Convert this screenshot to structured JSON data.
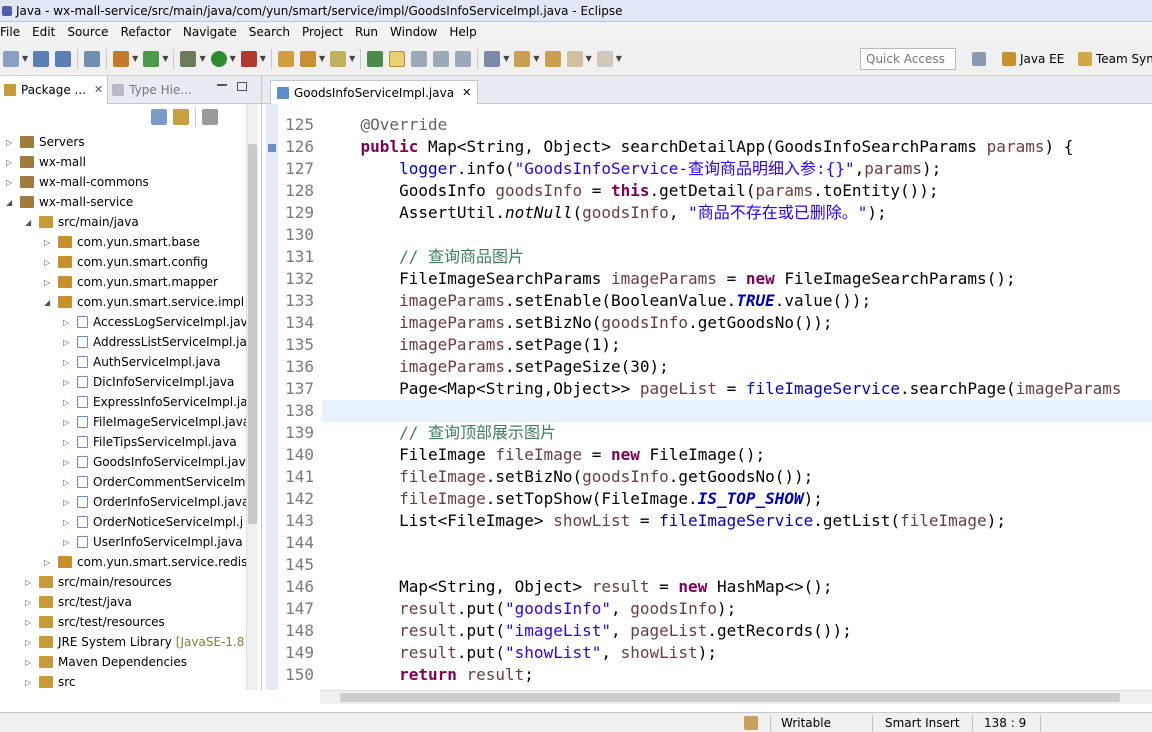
{
  "window": {
    "title": "Java - wx-mall-service/src/main/java/com/yun/smart/service/impl/GoodsInfoServiceImpl.java - Eclipse"
  },
  "menu": [
    "File",
    "Edit",
    "Source",
    "Refactor",
    "Navigate",
    "Search",
    "Project",
    "Run",
    "Window",
    "Help"
  ],
  "toolbar": {
    "quick_access_placeholder": "Quick Access",
    "perspectives": [
      "Java EE",
      "Team Syn"
    ]
  },
  "left_panel": {
    "tabs": [
      {
        "label": "Package ...",
        "close": "✕"
      },
      {
        "label": "Type Hie..."
      }
    ],
    "tree": [
      {
        "label": "Servers",
        "indent": 0,
        "expanded": false
      },
      {
        "label": "wx-mall",
        "indent": 0,
        "expanded": false
      },
      {
        "label": "wx-mall-commons",
        "indent": 0,
        "expanded": false
      },
      {
        "label": "wx-mall-service",
        "indent": 0,
        "expanded": true
      },
      {
        "label": "src/main/java",
        "indent": 1,
        "expanded": true
      },
      {
        "label": "com.yun.smart.base",
        "indent": 2,
        "expanded": false
      },
      {
        "label": "com.yun.smart.config",
        "indent": 2,
        "expanded": false
      },
      {
        "label": "com.yun.smart.mapper",
        "indent": 2,
        "expanded": false
      },
      {
        "label": "com.yun.smart.service.impl",
        "indent": 2,
        "expanded": true
      },
      {
        "label": "AccessLogServiceImpl.jav",
        "indent": 3,
        "expanded": false
      },
      {
        "label": "AddressListServiceImpl.ja",
        "indent": 3,
        "expanded": false
      },
      {
        "label": "AuthServiceImpl.java",
        "indent": 3,
        "expanded": false
      },
      {
        "label": "DicInfoServiceImpl.java",
        "indent": 3,
        "expanded": false
      },
      {
        "label": "ExpressInfoServiceImpl.ja",
        "indent": 3,
        "expanded": false
      },
      {
        "label": "FileImageServiceImpl.java",
        "indent": 3,
        "expanded": false
      },
      {
        "label": "FileTipsServiceImpl.java",
        "indent": 3,
        "expanded": false
      },
      {
        "label": "GoodsInfoServiceImpl.jav",
        "indent": 3,
        "expanded": false
      },
      {
        "label": "OrderCommentServiceIm",
        "indent": 3,
        "expanded": false
      },
      {
        "label": "OrderInfoServiceImpl.java",
        "indent": 3,
        "expanded": false
      },
      {
        "label": "OrderNoticeServiceImpl.j",
        "indent": 3,
        "expanded": false
      },
      {
        "label": "UserInfoServiceImpl.java",
        "indent": 3,
        "expanded": false
      },
      {
        "label": "com.yun.smart.service.redis",
        "indent": 2,
        "expanded": false
      },
      {
        "label": "src/main/resources",
        "indent": 1,
        "expanded": false
      },
      {
        "label": "src/test/java",
        "indent": 1,
        "expanded": false
      },
      {
        "label": "src/test/resources",
        "indent": 1,
        "expanded": false
      },
      {
        "label": "JRE System Library",
        "suffix": "[JavaSE-1.8]",
        "indent": 1,
        "expanded": false
      },
      {
        "label": "Maven Dependencies",
        "indent": 1,
        "expanded": false
      },
      {
        "label": "src",
        "indent": 1,
        "expanded": false
      }
    ]
  },
  "editor": {
    "tab": {
      "label": "GoodsInfoServiceImpl.java",
      "close": "✕"
    },
    "current_line": 138,
    "line_numbers": [
      "125",
      "126",
      "127",
      "128",
      "129",
      "130",
      "131",
      "132",
      "133",
      "134",
      "135",
      "136",
      "137",
      "138",
      "139",
      "140",
      "141",
      "142",
      "143",
      "144",
      "145",
      "146",
      "147",
      "148",
      "149",
      "150"
    ],
    "lines": [
      [
        {
          "t": "    "
        },
        {
          "t": "@Override",
          "c": "an"
        }
      ],
      [
        {
          "t": "    "
        },
        {
          "t": "public",
          "c": "kw"
        },
        {
          "t": " Map<String, Object> searchDetailApp(GoodsInfoSearchParams "
        },
        {
          "t": "params",
          "c": "var"
        },
        {
          "t": ") {"
        }
      ],
      [
        {
          "t": "        "
        },
        {
          "t": "logger",
          "c": "fld"
        },
        {
          "t": ".info("
        },
        {
          "t": "\"GoodsInfoService-查询商品明细入参:{}\"",
          "c": "st"
        },
        {
          "t": ","
        },
        {
          "t": "params",
          "c": "var"
        },
        {
          "t": ");"
        }
      ],
      [
        {
          "t": "        GoodsInfo "
        },
        {
          "t": "goodsInfo",
          "c": "var"
        },
        {
          "t": " = "
        },
        {
          "t": "this",
          "c": "kw"
        },
        {
          "t": ".getDetail("
        },
        {
          "t": "params",
          "c": "var"
        },
        {
          "t": ".toEntity());"
        }
      ],
      [
        {
          "t": "        AssertUtil."
        },
        {
          "t": "notNull",
          "c": "it"
        },
        {
          "t": "("
        },
        {
          "t": "goodsInfo",
          "c": "var"
        },
        {
          "t": ", "
        },
        {
          "t": "\"商品不存在或已删除。\"",
          "c": "st"
        },
        {
          "t": ");"
        }
      ],
      [
        {
          "t": ""
        }
      ],
      [
        {
          "t": "        "
        },
        {
          "t": "// 查询商品图片",
          "c": "cm"
        }
      ],
      [
        {
          "t": "        FileImageSearchParams "
        },
        {
          "t": "imageParams",
          "c": "var"
        },
        {
          "t": " = "
        },
        {
          "t": "new",
          "c": "kw"
        },
        {
          "t": " FileImageSearchParams();"
        }
      ],
      [
        {
          "t": "        "
        },
        {
          "t": "imageParams",
          "c": "var"
        },
        {
          "t": ".setEnable(BooleanValue."
        },
        {
          "t": "TRUE",
          "c": "sfi"
        },
        {
          "t": ".value());"
        }
      ],
      [
        {
          "t": "        "
        },
        {
          "t": "imageParams",
          "c": "var"
        },
        {
          "t": ".setBizNo("
        },
        {
          "t": "goodsInfo",
          "c": "var"
        },
        {
          "t": ".getGoodsNo());"
        }
      ],
      [
        {
          "t": "        "
        },
        {
          "t": "imageParams",
          "c": "var"
        },
        {
          "t": ".setPage(1);"
        }
      ],
      [
        {
          "t": "        "
        },
        {
          "t": "imageParams",
          "c": "var"
        },
        {
          "t": ".setPageSize(30);"
        }
      ],
      [
        {
          "t": "        Page<Map<String,Object>> "
        },
        {
          "t": "pageList",
          "c": "var"
        },
        {
          "t": " = "
        },
        {
          "t": "fileImageService",
          "c": "fld"
        },
        {
          "t": ".searchPage("
        },
        {
          "t": "imageParams",
          "c": "var"
        }
      ],
      [
        {
          "t": ""
        }
      ],
      [
        {
          "t": "        "
        },
        {
          "t": "// 查询顶部展示图片",
          "c": "cm"
        }
      ],
      [
        {
          "t": "        FileImage "
        },
        {
          "t": "fileImage",
          "c": "var"
        },
        {
          "t": " = "
        },
        {
          "t": "new",
          "c": "kw"
        },
        {
          "t": " FileImage();"
        }
      ],
      [
        {
          "t": "        "
        },
        {
          "t": "fileImage",
          "c": "var"
        },
        {
          "t": ".setBizNo("
        },
        {
          "t": "goodsInfo",
          "c": "var"
        },
        {
          "t": ".getGoodsNo());"
        }
      ],
      [
        {
          "t": "        "
        },
        {
          "t": "fileImage",
          "c": "var"
        },
        {
          "t": ".setTopShow(FileImage."
        },
        {
          "t": "IS_TOP_SHOW",
          "c": "sfi"
        },
        {
          "t": ");"
        }
      ],
      [
        {
          "t": "        List<FileImage> "
        },
        {
          "t": "showList",
          "c": "var"
        },
        {
          "t": " = "
        },
        {
          "t": "fileImageService",
          "c": "fld"
        },
        {
          "t": ".getList("
        },
        {
          "t": "fileImage",
          "c": "var"
        },
        {
          "t": ");"
        }
      ],
      [
        {
          "t": ""
        }
      ],
      [
        {
          "t": ""
        }
      ],
      [
        {
          "t": "        Map<String, Object> "
        },
        {
          "t": "result",
          "c": "var"
        },
        {
          "t": " = "
        },
        {
          "t": "new",
          "c": "kw"
        },
        {
          "t": " HashMap<>();"
        }
      ],
      [
        {
          "t": "        "
        },
        {
          "t": "result",
          "c": "var"
        },
        {
          "t": ".put("
        },
        {
          "t": "\"goodsInfo\"",
          "c": "st"
        },
        {
          "t": ", "
        },
        {
          "t": "goodsInfo",
          "c": "var"
        },
        {
          "t": ");"
        }
      ],
      [
        {
          "t": "        "
        },
        {
          "t": "result",
          "c": "var"
        },
        {
          "t": ".put("
        },
        {
          "t": "\"imageList\"",
          "c": "st"
        },
        {
          "t": ", "
        },
        {
          "t": "pageList",
          "c": "var"
        },
        {
          "t": ".getRecords());"
        }
      ],
      [
        {
          "t": "        "
        },
        {
          "t": "result",
          "c": "var"
        },
        {
          "t": ".put("
        },
        {
          "t": "\"showList\"",
          "c": "st"
        },
        {
          "t": ", "
        },
        {
          "t": "showList",
          "c": "var"
        },
        {
          "t": ");"
        }
      ],
      [
        {
          "t": "        "
        },
        {
          "t": "return",
          "c": "kw"
        },
        {
          "t": " "
        },
        {
          "t": "result",
          "c": "var"
        },
        {
          "t": ";"
        }
      ]
    ]
  },
  "status": {
    "writable": "Writable",
    "insert_mode": "Smart Insert",
    "position": "138 : 9"
  }
}
